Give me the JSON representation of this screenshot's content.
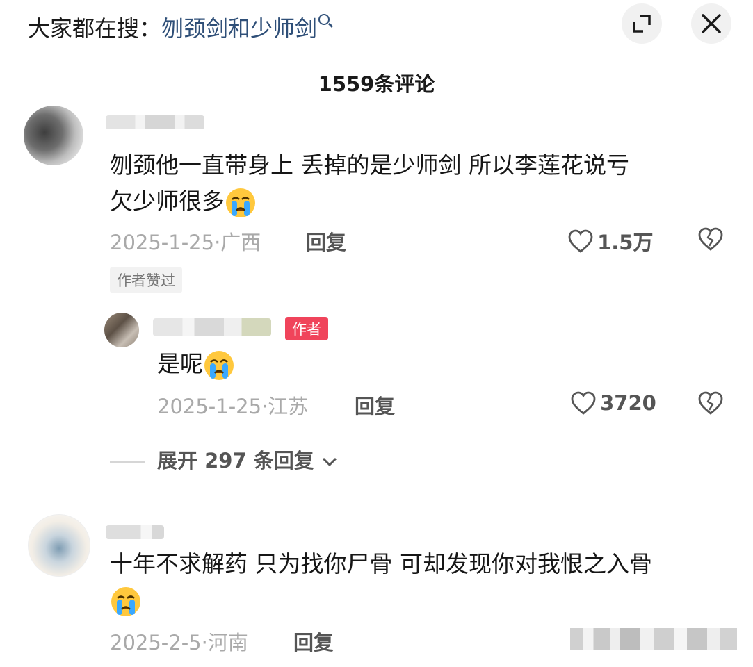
{
  "header": {
    "hot_label": "大家都在搜：",
    "hot_keyword": "刎颈剑和少师剑",
    "title": "1559条评论"
  },
  "comments": [
    {
      "text_line1": "刎颈他一直带身上  丢掉的是少师剑  所以李莲花说亏",
      "text_line2": "欠少师很多",
      "meta": "2025-1-25·广西",
      "reply_label": "回复",
      "like_count": "1.5万",
      "author_liked": "作者赞过",
      "reply": {
        "badge": "作者",
        "text": "是呢",
        "meta": "2025-1-25·江苏",
        "reply_label": "回复",
        "like_count": "3720"
      },
      "expand_label": "展开 297 条回复"
    },
    {
      "text_line1": "十年不求解药 只为找你尸骨 可却发现你对我恨之入骨",
      "meta": "2025-2-5·河南",
      "reply_label": "回复"
    }
  ],
  "colors": {
    "keyword": "#2f4f78",
    "author_badge": "#f0445b",
    "meta_text": "#a9a9a9"
  },
  "icons": [
    "search-icon",
    "expand-icon",
    "close-icon",
    "heart-icon",
    "broken-heart-icon",
    "crying-emoji-icon",
    "chevron-down-icon"
  ]
}
